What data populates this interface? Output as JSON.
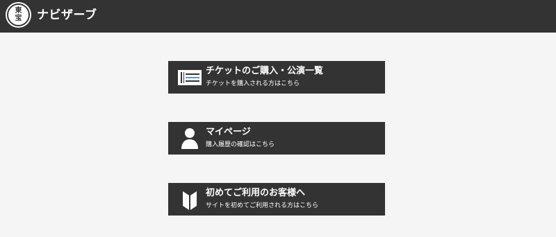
{
  "header": {
    "logo_line1": "東",
    "logo_line2": "宝",
    "title": "ナビザーブ"
  },
  "menu": {
    "items": [
      {
        "title": "チケットのご購入・公演一覧",
        "subtitle": "チケットを購入される方はこちら",
        "icon": "ticket-icon"
      },
      {
        "title": "マイページ",
        "subtitle": "購入履歴の確認はこちら",
        "icon": "user-icon"
      },
      {
        "title": "初めてご利用のお客様へ",
        "subtitle": "サイトを初めてご利用される方はこちら",
        "icon": "beginner-mark-icon"
      }
    ]
  },
  "colors": {
    "header_bg": "#333333",
    "page_bg": "#f5f5f5",
    "button_bg": "#333333",
    "text": "#ffffff",
    "ticket_accent": "#4aa3a8"
  }
}
